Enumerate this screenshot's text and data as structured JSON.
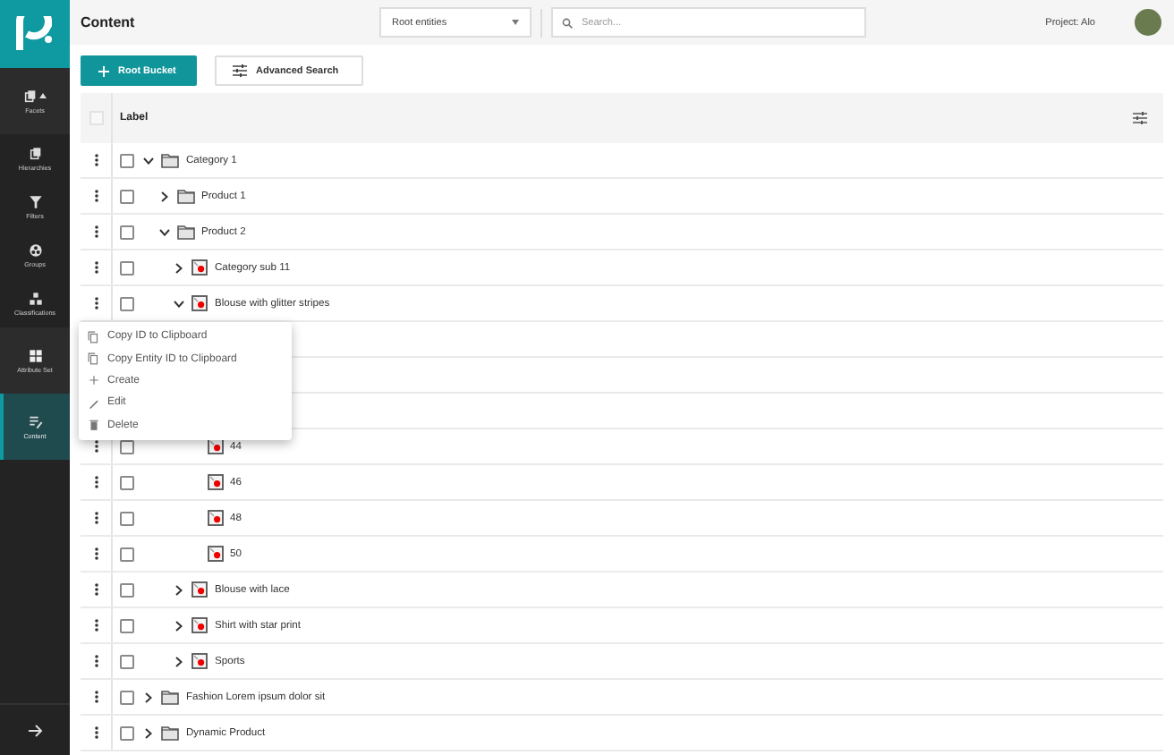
{
  "sidebar": {
    "items": [
      {
        "label": "Facets",
        "kind": "facets",
        "selected": false
      },
      {
        "label": "Hierarchies",
        "kind": "hierarchies",
        "selected": false
      },
      {
        "label": "Filters",
        "kind": "filters",
        "selected": false
      },
      {
        "label": "Groups",
        "kind": "groups",
        "selected": false
      },
      {
        "label": "Classifications",
        "kind": "classifications",
        "selected": false
      },
      {
        "label": "Attribute Set",
        "kind": "attributes",
        "selected": false
      },
      {
        "label": "Content",
        "kind": "content",
        "selected": true
      }
    ]
  },
  "topbar": {
    "title": "Content",
    "scope_select": {
      "value": "Root entities"
    },
    "search": {
      "placeholder": "Search..."
    },
    "project": "Project: Alo"
  },
  "toolbar": {
    "buttons": [
      {
        "label": "Root Bucket",
        "kind": "primary"
      },
      {
        "label": "Advanced Search",
        "kind": "secondary"
      }
    ]
  },
  "table": {
    "select_all": {
      "checked": false
    },
    "columns": [
      {
        "label": "Label"
      }
    ],
    "rows": [
      {
        "label": "Category 1",
        "kind": "folder",
        "checked": false,
        "expanded": true,
        "children": [
          {
            "label": "Product 1",
            "kind": "folder",
            "checked": false,
            "expanded": false
          },
          {
            "label": "Product 2",
            "kind": "folder",
            "checked": false,
            "expanded": true,
            "children": [
              {
                "label": "Category sub 11",
                "kind": "product",
                "checked": false,
                "expanded": false
              },
              {
                "label": "Blouse with glitter stripes",
                "kind": "product",
                "checked": false,
                "expanded": true,
                "menu_open": true,
                "children": [
                  {
                    "label": "44",
                    "kind": "product",
                    "checked": false
                  },
                  {
                    "label": "46",
                    "kind": "product",
                    "checked": false
                  },
                  {
                    "label": "48",
                    "kind": "product",
                    "checked": false
                  },
                  {
                    "label": "50",
                    "kind": "product",
                    "checked": false
                  }
                ]
              },
              {
                "label": "Blouse with lace",
                "kind": "product",
                "checked": false,
                "expanded": false
              },
              {
                "label": "Shirt with star print",
                "kind": "product",
                "checked": false,
                "expanded": false
              },
              {
                "label": "Sports",
                "kind": "product",
                "checked": false,
                "expanded": false
              }
            ]
          }
        ]
      },
      {
        "label": "Fashion Lorem ipsum dolor sit",
        "kind": "folder",
        "checked": false,
        "expanded": false
      },
      {
        "label": "Dynamic Product",
        "kind": "folder",
        "checked": false,
        "expanded": false
      }
    ]
  },
  "context_menu": {
    "items": [
      {
        "label": "Copy ID to Clipboard",
        "kind": "copy"
      },
      {
        "label": "Copy Entity ID to Clipboard",
        "kind": "copy"
      },
      {
        "label": "Create",
        "kind": "create"
      },
      {
        "label": "Edit",
        "kind": "edit"
      },
      {
        "label": "Delete",
        "kind": "delete"
      }
    ]
  }
}
